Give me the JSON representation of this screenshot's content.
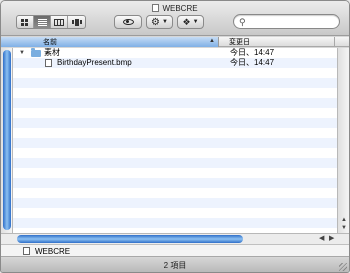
{
  "window": {
    "title": "WEBCRE"
  },
  "toolbar": {
    "view_icon": "icon-view",
    "list_view_icon": "list-view",
    "column_view_icon": "column-view",
    "cover_flow_icon": "cover-flow",
    "quick_look_icon": "eye-icon",
    "action_icon": "gear-icon",
    "dropbox_icon": "dropbox-icon",
    "search_placeholder": ""
  },
  "columns": {
    "name": "名前",
    "date": "変更日"
  },
  "rows": [
    {
      "name": "素材",
      "date": "今日、14:47",
      "kind": "folder",
      "expanded": true
    },
    {
      "name": "BirthdayPresent.bmp",
      "date": "今日、14:47",
      "kind": "file"
    }
  ],
  "pathbar": {
    "label": "WEBCRE"
  },
  "status": {
    "text": "2 項目"
  },
  "colors": {
    "accent": "#3d7fd6",
    "stripe": "#edf3fe"
  }
}
